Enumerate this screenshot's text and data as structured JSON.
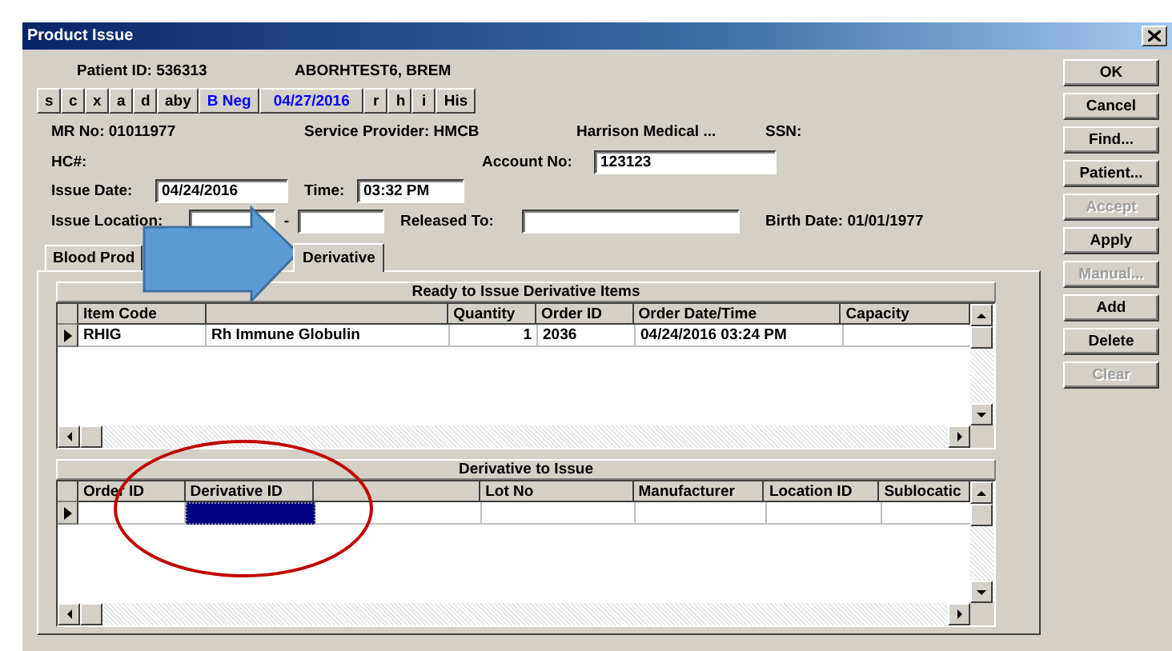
{
  "window": {
    "title": "Product Issue"
  },
  "patient": {
    "id": "Patient ID: 536313",
    "name": "ABORHTEST6, BREM"
  },
  "quick_buttons": [
    {
      "label": "s",
      "color": "#000000"
    },
    {
      "label": "c",
      "color": "#000000"
    },
    {
      "label": "x",
      "color": "#000000"
    },
    {
      "label": "a",
      "color": "#000000"
    },
    {
      "label": "d",
      "color": "#000000"
    },
    {
      "label": "aby",
      "color": "#000000"
    },
    {
      "label": "B Neg",
      "color": "#0000ff"
    },
    {
      "label": "04/27/2016",
      "color": "#0000ff"
    },
    {
      "label": "r",
      "color": "#000000"
    },
    {
      "label": "h",
      "color": "#000000"
    },
    {
      "label": "i",
      "color": "#000000"
    },
    {
      "label": "His",
      "color": "#000000"
    }
  ],
  "info": {
    "mr_no": "MR No: 01011977",
    "service_provider": "Service Provider: HMCB",
    "facility": "Harrison Medical ...",
    "ssn": "SSN:",
    "hc": "HC#:",
    "birth_date": "Birth Date: 01/01/1977"
  },
  "account_no": {
    "label": "Account No:",
    "value": "123123"
  },
  "issue_date": {
    "label": "Issue Date:",
    "value": "04/24/2016"
  },
  "time": {
    "label": "Time:",
    "value": "03:32 PM"
  },
  "issue_location": {
    "label": "Issue Location:",
    "separator": "-"
  },
  "released_to": {
    "label": "Released To:"
  },
  "tabs": [
    {
      "label": "Blood Prod",
      "selected": false
    },
    {
      "label": "Derivative",
      "selected": true
    }
  ],
  "ready_grid": {
    "caption": "Ready to Issue Derivative Items",
    "columns": [
      {
        "kind": "text",
        "title": "Item Code"
      },
      {
        "kind": "blank"
      },
      {
        "kind": "number",
        "title": "Quantity"
      },
      {
        "kind": "text",
        "title": "Order ID"
      },
      {
        "kind": "text",
        "title": "Order Date/Time"
      },
      {
        "kind": "text",
        "title": "Capacity"
      }
    ],
    "rows": [
      {
        "current": true,
        "cells": [
          {
            "text": "RHIG",
            "selected": false
          },
          {
            "text": "Rh Immune Globulin",
            "selected": false
          },
          {
            "text": "1",
            "selected": false
          },
          {
            "text": "2036",
            "selected": false
          },
          {
            "text": "04/24/2016 03:24 PM",
            "selected": false
          },
          {
            "selected": false
          }
        ]
      }
    ]
  },
  "issue_grid": {
    "caption": "Derivative to Issue",
    "columns": [
      {
        "kind": "text",
        "title": "Order ID"
      },
      {
        "kind": "text",
        "title": "Derivative ID"
      },
      {
        "kind": "blank"
      },
      {
        "kind": "text",
        "title": "Lot No"
      },
      {
        "kind": "text",
        "title": "Manufacturer"
      },
      {
        "kind": "text",
        "title": "Location ID"
      },
      {
        "kind": "text",
        "title": "Sublocatic"
      }
    ],
    "rows": [
      {
        "current": true,
        "cells": [
          {
            "selected": false
          },
          {
            "selected": true
          },
          {
            "selected": false
          },
          {
            "selected": false
          },
          {
            "selected": false
          },
          {
            "selected": false
          },
          {
            "selected": false
          }
        ]
      }
    ]
  },
  "buttons": [
    {
      "label": "OK",
      "disabled": false
    },
    {
      "label": "Cancel",
      "disabled": false
    },
    {
      "label": "Find...",
      "disabled": false
    },
    {
      "label": "Patient...",
      "disabled": false
    },
    {
      "label": "Accept",
      "disabled": true
    },
    {
      "label": "Apply",
      "disabled": false
    },
    {
      "label": "Manual...",
      "disabled": true
    },
    {
      "label": "Add",
      "disabled": false
    },
    {
      "label": "Delete",
      "disabled": false
    },
    {
      "label": "Clear",
      "disabled": true
    }
  ]
}
